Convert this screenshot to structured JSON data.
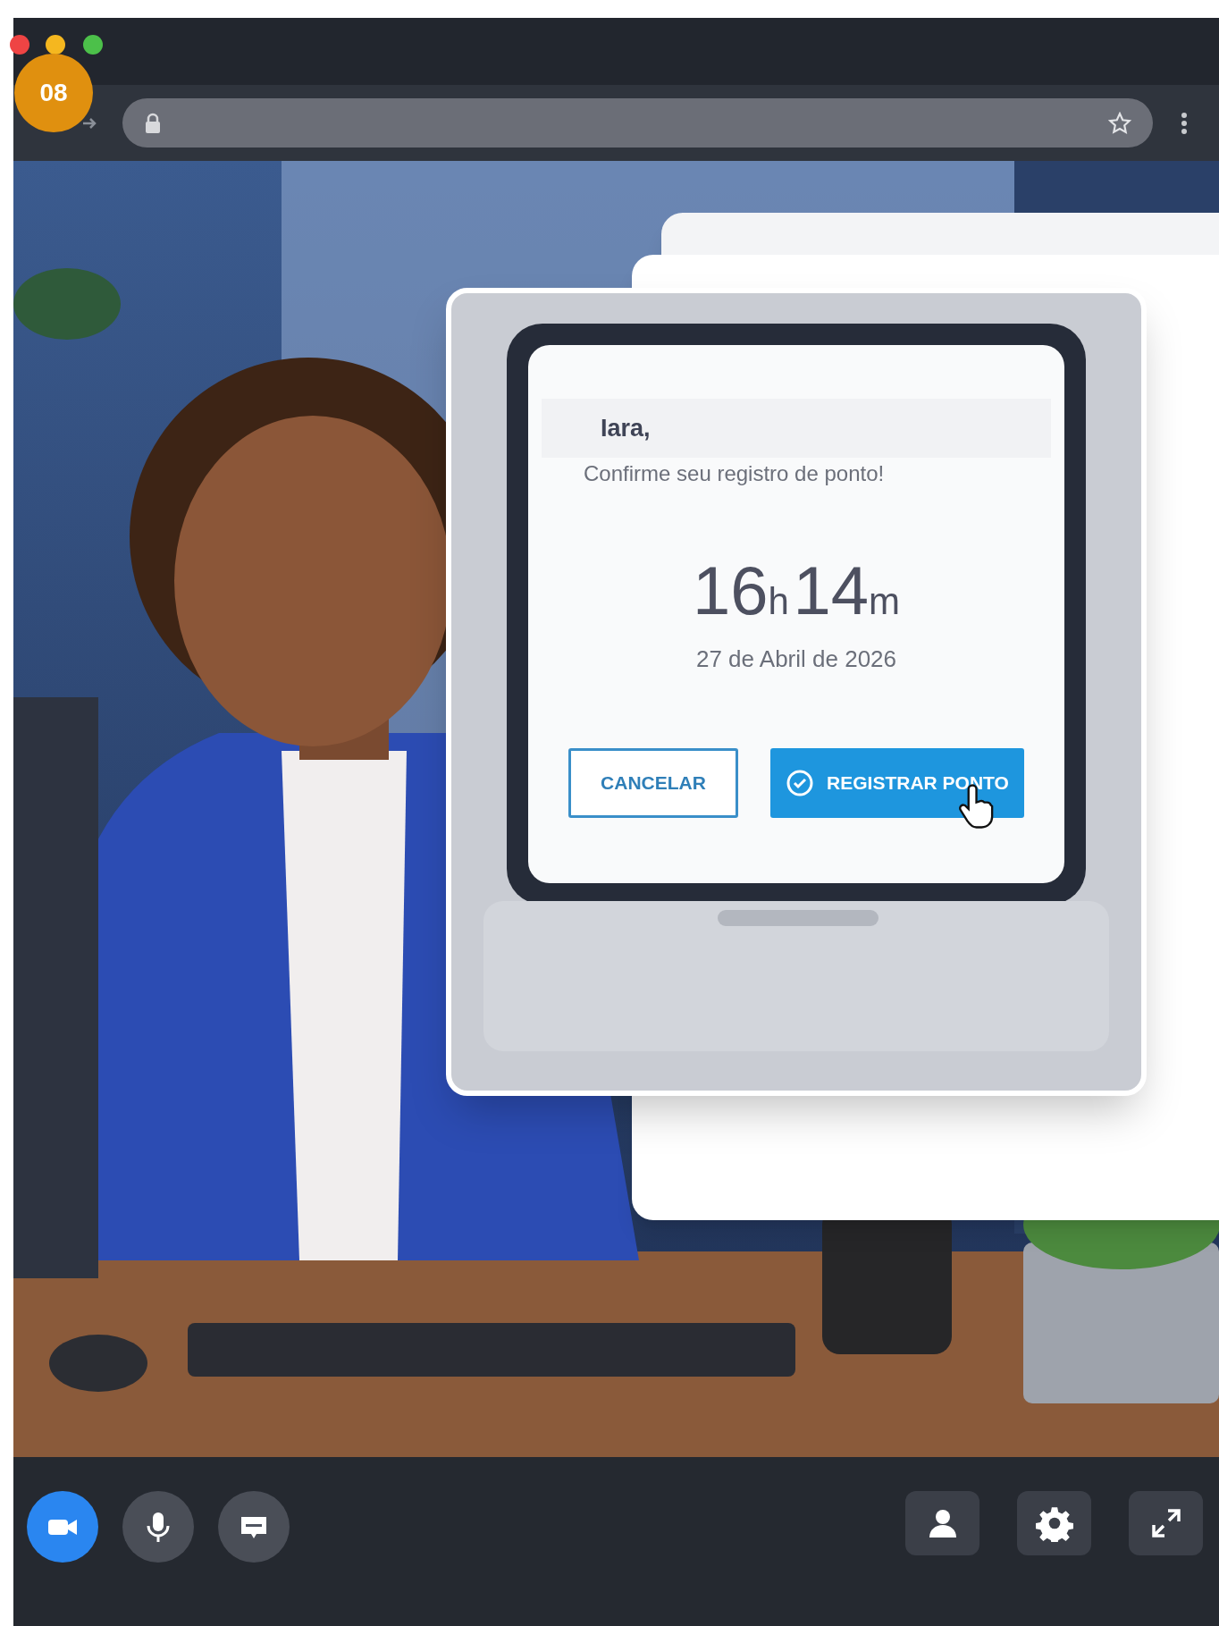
{
  "step_badge": "08",
  "dialog": {
    "greeting": "Iara,",
    "message": "Confirme seu registro de ponto!",
    "hours": "16",
    "hours_unit": "h",
    "minutes": "14",
    "minutes_unit": "m",
    "date": "27 de Abril de 2026",
    "buttons": [
      {
        "label": "CANCELAR",
        "kind": "outline"
      },
      {
        "label": "REGISTRAR PONTO",
        "kind": "primary"
      }
    ]
  },
  "call_controls": [
    {
      "kind": "camera",
      "selected": true
    },
    {
      "kind": "mic",
      "selected": false
    },
    {
      "kind": "chat",
      "selected": false
    }
  ],
  "toolbar": [
    {
      "kind": "person"
    },
    {
      "kind": "settings"
    },
    {
      "kind": "expand"
    }
  ]
}
